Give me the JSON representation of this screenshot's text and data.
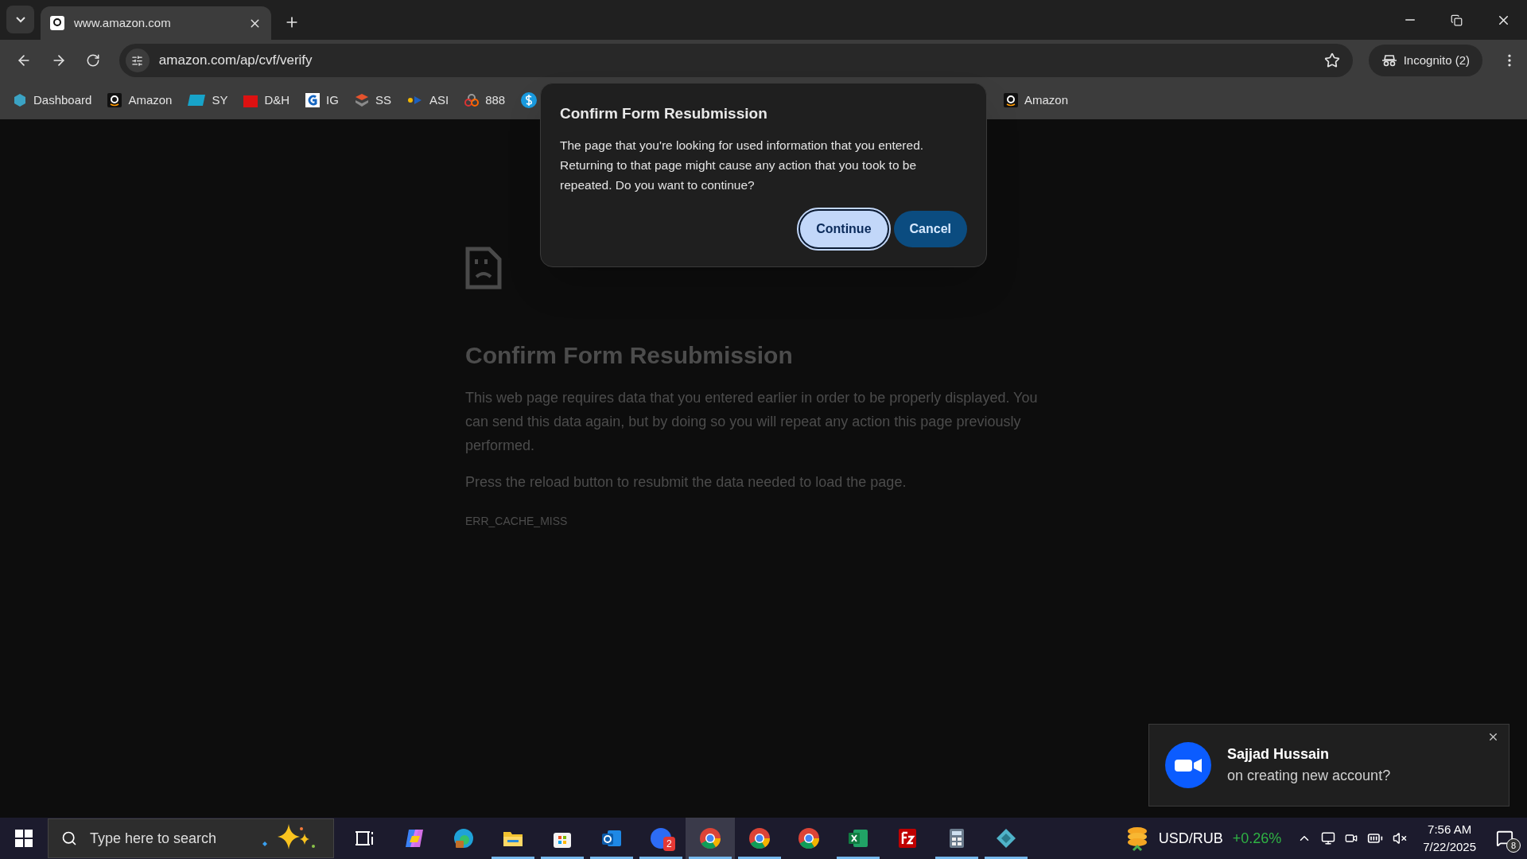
{
  "tab": {
    "title": "www.amazon.com",
    "selected": true
  },
  "address_bar": {
    "url": "amazon.com/ap/cvf/verify"
  },
  "profile": {
    "label": "Incognito (2)"
  },
  "bookmarks_left": [
    {
      "kind": "dashboard",
      "label": "Dashboard"
    },
    {
      "kind": "amazon",
      "label": "Amazon"
    },
    {
      "kind": "ec",
      "label": "SY"
    },
    {
      "kind": "dh",
      "label": "D&H"
    },
    {
      "kind": "ig",
      "label": "IG"
    },
    {
      "kind": "ss",
      "label": "SS"
    },
    {
      "kind": "asi",
      "label": "ASI"
    },
    {
      "kind": "rings",
      "label": "888"
    },
    {
      "kind": "dollar"
    }
  ],
  "bookmarks_right": [
    {
      "kind": "amazon",
      "label": "Amazon"
    }
  ],
  "dialog": {
    "title": "Confirm Form Resubmission",
    "message": "The page that you're looking for used information that you entered. Returning to that page might cause any action that you took to be repeated. Do you want to continue?",
    "buttons": [
      {
        "label": "Continue",
        "focused": true
      },
      {
        "label": "Cancel",
        "focused": false
      }
    ]
  },
  "error_page": {
    "title": "Confirm Form Resubmission",
    "paragraphs": [
      "This web page requires data that you entered earlier in order to be properly displayed. You can send this data again, but by doing so you will repeat any action this page previously performed.",
      "Press the reload button to resubmit the data needed to load the page."
    ],
    "code": "ERR_CACHE_MISS"
  },
  "notification": {
    "sender": "Sajjad Hussain",
    "message": "on creating new account?"
  },
  "taskbar": {
    "search_placeholder": "Type here to search",
    "apps": [
      {
        "kind": "taskview",
        "running": false,
        "active": false
      },
      {
        "kind": "copilot",
        "running": false,
        "active": false
      },
      {
        "kind": "edge",
        "running": false,
        "active": false
      },
      {
        "kind": "folder",
        "running": true,
        "active": false
      },
      {
        "kind": "store",
        "running": true,
        "active": false
      },
      {
        "kind": "outlook",
        "running": true,
        "active": false
      },
      {
        "kind": "zoom",
        "running": true,
        "active": false,
        "badge": "2"
      },
      {
        "kind": "chrome",
        "running": true,
        "active": true
      },
      {
        "kind": "chrome",
        "running": true,
        "active": false
      },
      {
        "kind": "chrome",
        "running": false,
        "active": false
      },
      {
        "kind": "excel",
        "running": true,
        "active": false
      },
      {
        "kind": "filezilla",
        "running": false,
        "active": false
      },
      {
        "kind": "calculator",
        "running": true,
        "active": false
      },
      {
        "kind": "diamond",
        "running": true,
        "active": false
      }
    ],
    "widget": {
      "label": "USD/RUB",
      "change": "+0.26%"
    },
    "time": "7:56 AM",
    "date": "7/22/2025",
    "notification_count": "8"
  }
}
